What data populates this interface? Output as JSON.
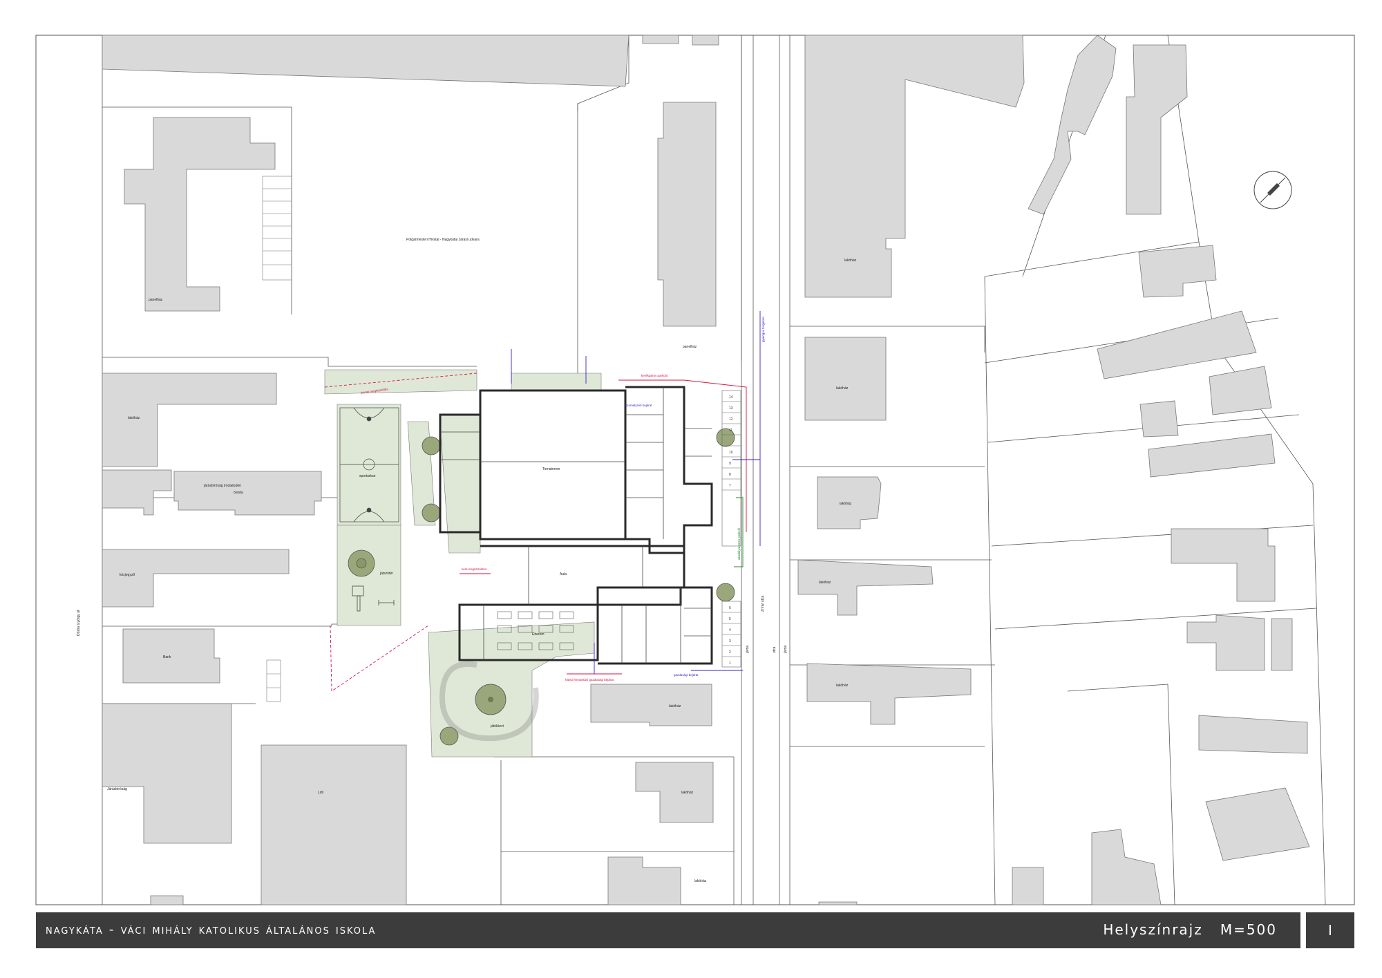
{
  "title_block": {
    "project": "nagykáta - váci mihály katolikus általános iskola",
    "sheet": "Helyszínrajz",
    "scale": "M=500",
    "page": "I"
  },
  "site_labels": {
    "panelhaz_1": "panelház",
    "panelhaz_2": "panelház",
    "polgarmesteri": "Polgármesteri Hivatal - Nagykátai Járási\nudvara",
    "lakohaz_nw": "lakóház",
    "jarasi": "járásbíróság irodaépület",
    "ovoda": "óvoda",
    "kozjegyzo": "közjegyző",
    "bank": "Bank",
    "jarasbirosag": "Járásbíróság",
    "lidl": "Lidl",
    "lakohaz_e1": "lakóház",
    "lakohaz_e2": "lakóház",
    "lakohaz_e3": "lakóház",
    "lakohaz_e4": "lakóház",
    "lakohaz_e5": "lakóház",
    "lakohaz_s1": "lakóház",
    "lakohaz_s2": "lakóház",
    "lakohaz_s3": "lakóház",
    "sportudvar": "sportudvar",
    "jatszoter": "játszótér",
    "tornaterem": "Tornaterem",
    "aula": "Aula",
    "etterem": "Étterem",
    "jatekkert": "játékkert",
    "street_west": "Dózsa György út",
    "street_east": "Zrínyi utca",
    "jarda": "járda",
    "utca": "utca"
  },
  "annotations": {
    "red_1": "kerékpáros parkoló",
    "red_2": "kerti megközelítés",
    "red_3": "hátsó fenntartási gazdasági bejárat",
    "red_4": "iskolai megközelítés",
    "blue_1": "személyzeti bejárat",
    "blue_2": "gazdasági bejárat",
    "blue_3": "gyalogos forgalom",
    "green_1": "akadálymentes parkoló",
    "parking_numbers": [
      "14",
      "13",
      "12",
      "11",
      "10",
      "9",
      "8",
      "7",
      "6",
      "5",
      "4",
      "3",
      "2",
      "1"
    ]
  },
  "colors": {
    "building_fill": "#d9d9d9",
    "green_fill": "#dfe8d6",
    "tree_fill": "#9aa77a",
    "wall": "#2a2a2a",
    "red": "#d6123f",
    "blue": "#3a1fc4",
    "green": "#1f8a2e",
    "title_bar": "#3c3c3c"
  },
  "icons": {
    "north_arrow": "north-arrow-icon"
  }
}
